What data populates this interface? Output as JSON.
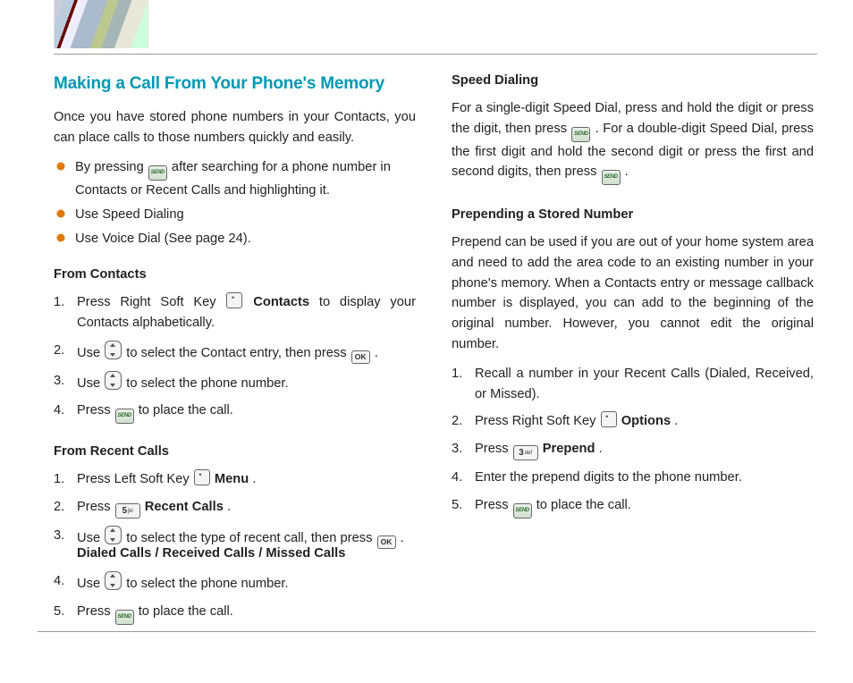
{
  "title": "Making a Call From Your Phone's Memory",
  "intro": "Once you have stored phone numbers in your Contacts, you can place calls to those numbers quickly and easily.",
  "bullets": {
    "b1a": "By pressing ",
    "b1b": " after searching for a phone number in Contacts or Recent Calls and highlighting it.",
    "b2": "Use Speed Dialing",
    "b3": "Use Voice Dial (See page 24)."
  },
  "s1_head": "From Contacts",
  "s1": {
    "i1a": "Press Right Soft Key ",
    "i1b": "Contacts",
    "i1c": " to display your Contacts alphabetically.",
    "i2a": "Use ",
    "i2b": " to select the Contact entry, then press ",
    "i2c": ".",
    "i3a": "Use ",
    "i3b": " to select the phone number.",
    "i4a": "Press ",
    "i4b": " to place the call."
  },
  "s2_head": "From Recent Calls",
  "s2": {
    "i1a": "Press Left Soft Key ",
    "i1b": "Menu",
    "i1c": ".",
    "i2a": "Press ",
    "i2b": "Recent Calls",
    "i2c": ".",
    "i3a": "Use ",
    "i3b": " to select the type of recent call, then press ",
    "i3c": ".",
    "sub": "Dialed Calls / Received Calls / Missed Calls",
    "i4a": "Use ",
    "i4b": " to select the phone number.",
    "i5a": "Press ",
    "i5b": " to place the call."
  },
  "s3_head": "Speed Dialing",
  "s3": {
    "p1a": "For a single-digit Speed Dial, press and hold the digit or press the digit, then press ",
    "p1b": ". For a double-digit Speed Dial, press the first digit and hold the second digit or press the first and second digits, then press ",
    "p1c": "."
  },
  "s4_head": "Prepending a Stored Number",
  "s4": {
    "p": "Prepend can be used if you are out of your home system area and need to add the area code to an existing number in your phone's memory. When a Contacts entry or message callback number is displayed, you can add to the beginning of the original number. However, you cannot edit the original number.",
    "i1": "Recall a number in your Recent Calls (Dialed, Received, or Missed).",
    "i2a": "Press Right Soft Key ",
    "i2b": "Options",
    "i2c": ".",
    "i3a": "Press ",
    "i3b": "Prepend",
    "i3c": ".",
    "i4": "Enter the prepend digits to the phone number.",
    "i5a": "Press ",
    "i5b": " to place the call."
  },
  "keys": {
    "ok": "OK",
    "send": "SEND",
    "five": "5",
    "five_sub": "jkl",
    "three": "3",
    "three_sub": "def"
  }
}
